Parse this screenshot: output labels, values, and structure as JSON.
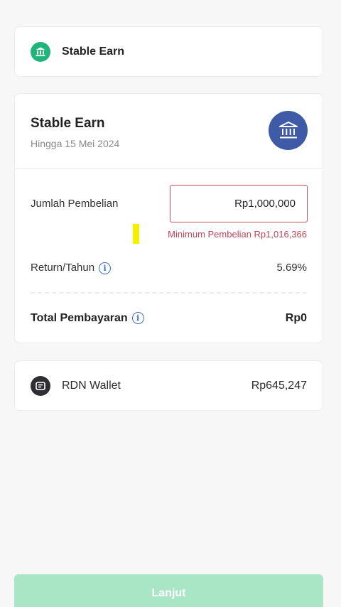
{
  "header_card": {
    "title": "Stable Earn",
    "icon": "bank-icon"
  },
  "product": {
    "title": "Stable Earn",
    "subtitle": "Hingga 15 Mei 2024",
    "icon": "bank-icon",
    "icon_bg": "#3f5ba7"
  },
  "purchase": {
    "label": "Jumlah Pembelian",
    "amount": "Rp1,000,000",
    "error": "Minimum Pembelian Rp1,016,366",
    "error_color": "#c14559"
  },
  "return_row": {
    "label": "Return/Tahun",
    "value": "5.69%",
    "icon": "info-icon"
  },
  "total": {
    "label": "Total Pembayaran",
    "value": "Rp0",
    "icon": "info-icon"
  },
  "wallet": {
    "label": "RDN Wallet",
    "balance": "Rp645,247",
    "icon": "wallet-icon"
  },
  "footer": {
    "button_label": "Lanjut",
    "button_color": "#a8e6c6"
  },
  "accent": "#1fb57a"
}
